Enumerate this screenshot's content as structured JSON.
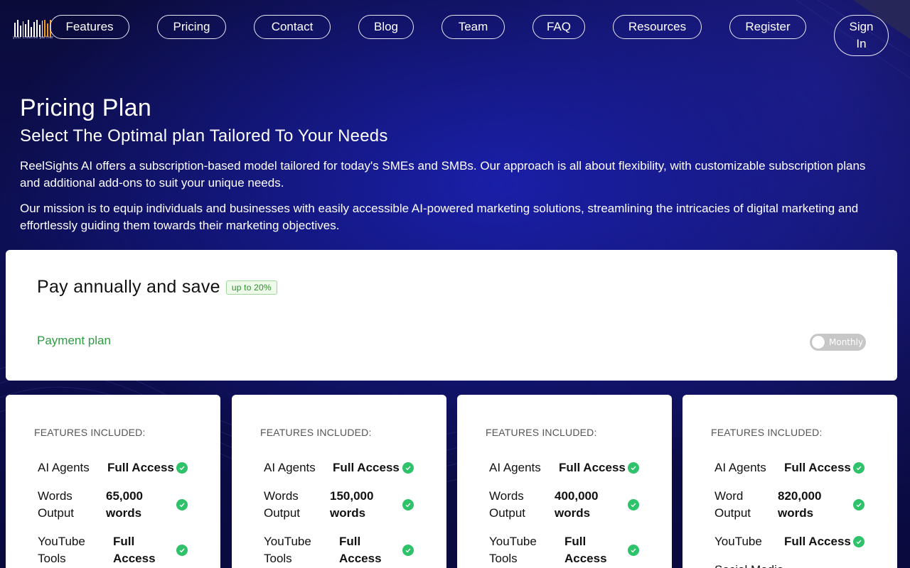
{
  "brand": {
    "logo_text": "ReelSights AI",
    "logo_tagline": "your creative partner"
  },
  "nav": {
    "items": [
      "Features",
      "Pricing",
      "Contact",
      "Blog",
      "Team",
      "FAQ",
      "Resources",
      "Register"
    ],
    "signin_line1": "Sign",
    "signin_line2": "In"
  },
  "hero": {
    "title": "Pricing Plan",
    "subtitle": "Select The Optimal plan Tailored To Your Needs",
    "para1": "ReelSights AI offers a subscription-based model tailored for today's SMEs and SMBs. Our approach is all about flexibility, with customizable subscription plans and additional add-ons to suit your unique needs.",
    "para2": "Our mission is to equip individuals and businesses with easily accessible AI-powered marketing solutions, streamlining the intricacies of digital marketing and effortlessly guiding them towards their marketing objectives."
  },
  "billing": {
    "title": "Pay annually and save",
    "badge": "up to 20%",
    "payment_plan_label": "Payment plan",
    "toggle_label": "Monthly",
    "toggle_on": false
  },
  "plans": [
    {
      "features_heading": "FEATURES INCLUDED:",
      "rows": [
        {
          "l1": "AI Agents",
          "l2": "",
          "v1": "Full Access",
          "v2": ""
        },
        {
          "l1": "Words",
          "l2": "Output",
          "v1": "65,000",
          "v2": "words"
        },
        {
          "l1": "YouTube",
          "l2": "Tools",
          "v1": "Full",
          "v2": "Access"
        }
      ]
    },
    {
      "features_heading": "FEATURES INCLUDED:",
      "rows": [
        {
          "l1": "AI Agents",
          "l2": "",
          "v1": "Full Access",
          "v2": ""
        },
        {
          "l1": "Words",
          "l2": "Output",
          "v1": "150,000",
          "v2": "words"
        },
        {
          "l1": "YouTube",
          "l2": "Tools",
          "v1": "Full",
          "v2": "Access"
        }
      ]
    },
    {
      "features_heading": "FEATURES INCLUDED:",
      "rows": [
        {
          "l1": "AI Agents",
          "l2": "",
          "v1": "Full Access",
          "v2": ""
        },
        {
          "l1": "Words",
          "l2": "Output",
          "v1": "400,000",
          "v2": "words"
        },
        {
          "l1": "YouTube",
          "l2": "Tools",
          "v1": "Full",
          "v2": "Access"
        }
      ]
    },
    {
      "features_heading": "FEATURES INCLUDED:",
      "rows": [
        {
          "l1": "AI Agents",
          "l2": "",
          "v1": "Full Access",
          "v2": ""
        },
        {
          "l1": "Word",
          "l2": "Output",
          "v1": "820,000",
          "v2": "words"
        },
        {
          "l1": "YouTube",
          "l2": "",
          "v1": "Full Access",
          "v2": ""
        },
        {
          "l1": "Social Media",
          "l2": "",
          "v1": "",
          "v2": ""
        }
      ]
    }
  ],
  "colors": {
    "accent_green": "#2ec26a",
    "link_green": "#2e9b43",
    "brand_orange": "#f39a1f"
  }
}
